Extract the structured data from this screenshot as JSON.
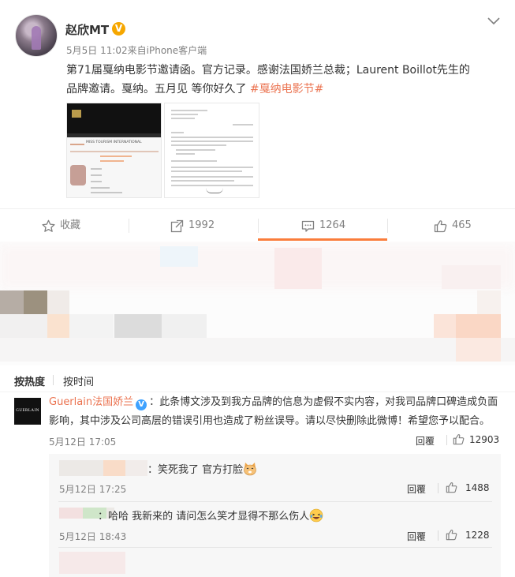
{
  "post": {
    "user_name": "赵欣MT",
    "verified_badge": "V",
    "meta": "5月5日 11:02来自iPhone客户端",
    "text_lines": [
      "第71届戛纳电影节邀请函。官方记录。感谢法国娇兰总裁；Laurent Boillot先生的",
      "品牌邀请。戛纳。五月见 等你好久了 "
    ],
    "hashtag": "#戛纳电影节#",
    "thumb1_caption": "MISS TOURISM INTERNATIONAL"
  },
  "actions": {
    "favorite_label": "收藏",
    "share_count": "1992",
    "comment_count": "1264",
    "like_count": "465"
  },
  "sort": {
    "hot_label": "按热度",
    "time_label": "按时间"
  },
  "comment": {
    "author": "Guerlain法国娇兰",
    "verified_badge": "V",
    "text_line1": "：此条博文涉及到我方品牌的信息为虚假不实内容，对我司品牌口碑造成负面",
    "text_line2": "影响，其中涉及公司高层的错误引用也造成了粉丝误导。请以尽快删除此微博！希望您予以配合。",
    "logo_text": "GUERLAIN",
    "time": "5月12日 17:05",
    "reply_label": "回覆",
    "likes": "12903"
  },
  "replies": [
    {
      "text": "：笑死我了 官方打脸",
      "emoji": "cat-face",
      "time": "5月12日 17:25",
      "reply_label": "回覆",
      "likes": "1488"
    },
    {
      "text": "：哈哈 我新来的 请问怎么笑才显得不那么伤人",
      "emoji": "laughing-face",
      "time": "5月12日 18:43",
      "reply_label": "回覆",
      "likes": "1228"
    }
  ],
  "colors": {
    "accent": "#eb7350",
    "tab_underline": "#fa7d3c",
    "verified_gold": "#f6a700",
    "verified_blue": "#3fa2ff"
  }
}
